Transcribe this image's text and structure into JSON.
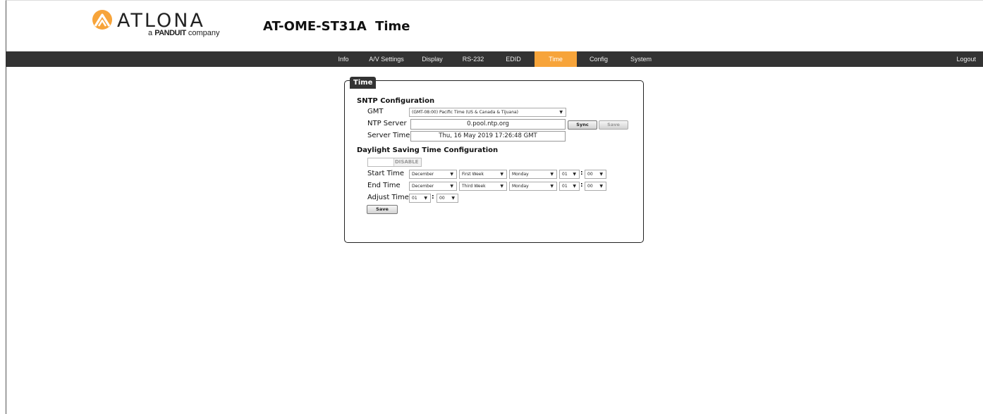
{
  "brand": {
    "name": "ATLONA",
    "tagline_prefix": "a",
    "tagline_brand": "PANDUIT",
    "tagline_suffix": "company",
    "accent_color": "#f7a43a"
  },
  "page_title": "AT-OME-ST31A  Time",
  "nav": {
    "items": [
      {
        "label": "Info"
      },
      {
        "label": "A/V Settings"
      },
      {
        "label": "Display"
      },
      {
        "label": "RS-232"
      },
      {
        "label": "EDID"
      },
      {
        "label": "Time",
        "active": true
      },
      {
        "label": "Config"
      },
      {
        "label": "System"
      }
    ],
    "logout": "Logout"
  },
  "panel": {
    "tab": "Time",
    "sntp": {
      "title": "SNTP Configuration",
      "gmt_label": "GMT",
      "gmt_value": "(GMT-08:00) Pacific Time (US & Canada & Tijuana)",
      "ntp_label": "NTP Server",
      "ntp_value": "0.pool.ntp.org",
      "sync_label": "Sync",
      "save_label": "Save",
      "server_time_label": "Server Time",
      "server_time_value": "Thu, 16 May 2019 17:26:48 GMT"
    },
    "dst": {
      "title": "Daylight Saving Time Configuration",
      "toggle_label": "DISABLE",
      "start_label": "Start Time",
      "start": {
        "month": "December",
        "week": "First Week",
        "day": "Monday",
        "hour": "01",
        "minute": "00"
      },
      "end_label": "End Time",
      "end": {
        "month": "December",
        "week": "Third Week",
        "day": "Monday",
        "hour": "01",
        "minute": "00"
      },
      "adjust_label": "Adjust Time",
      "adjust": {
        "hour": "01",
        "minute": "00"
      },
      "save_label": "Save"
    }
  }
}
